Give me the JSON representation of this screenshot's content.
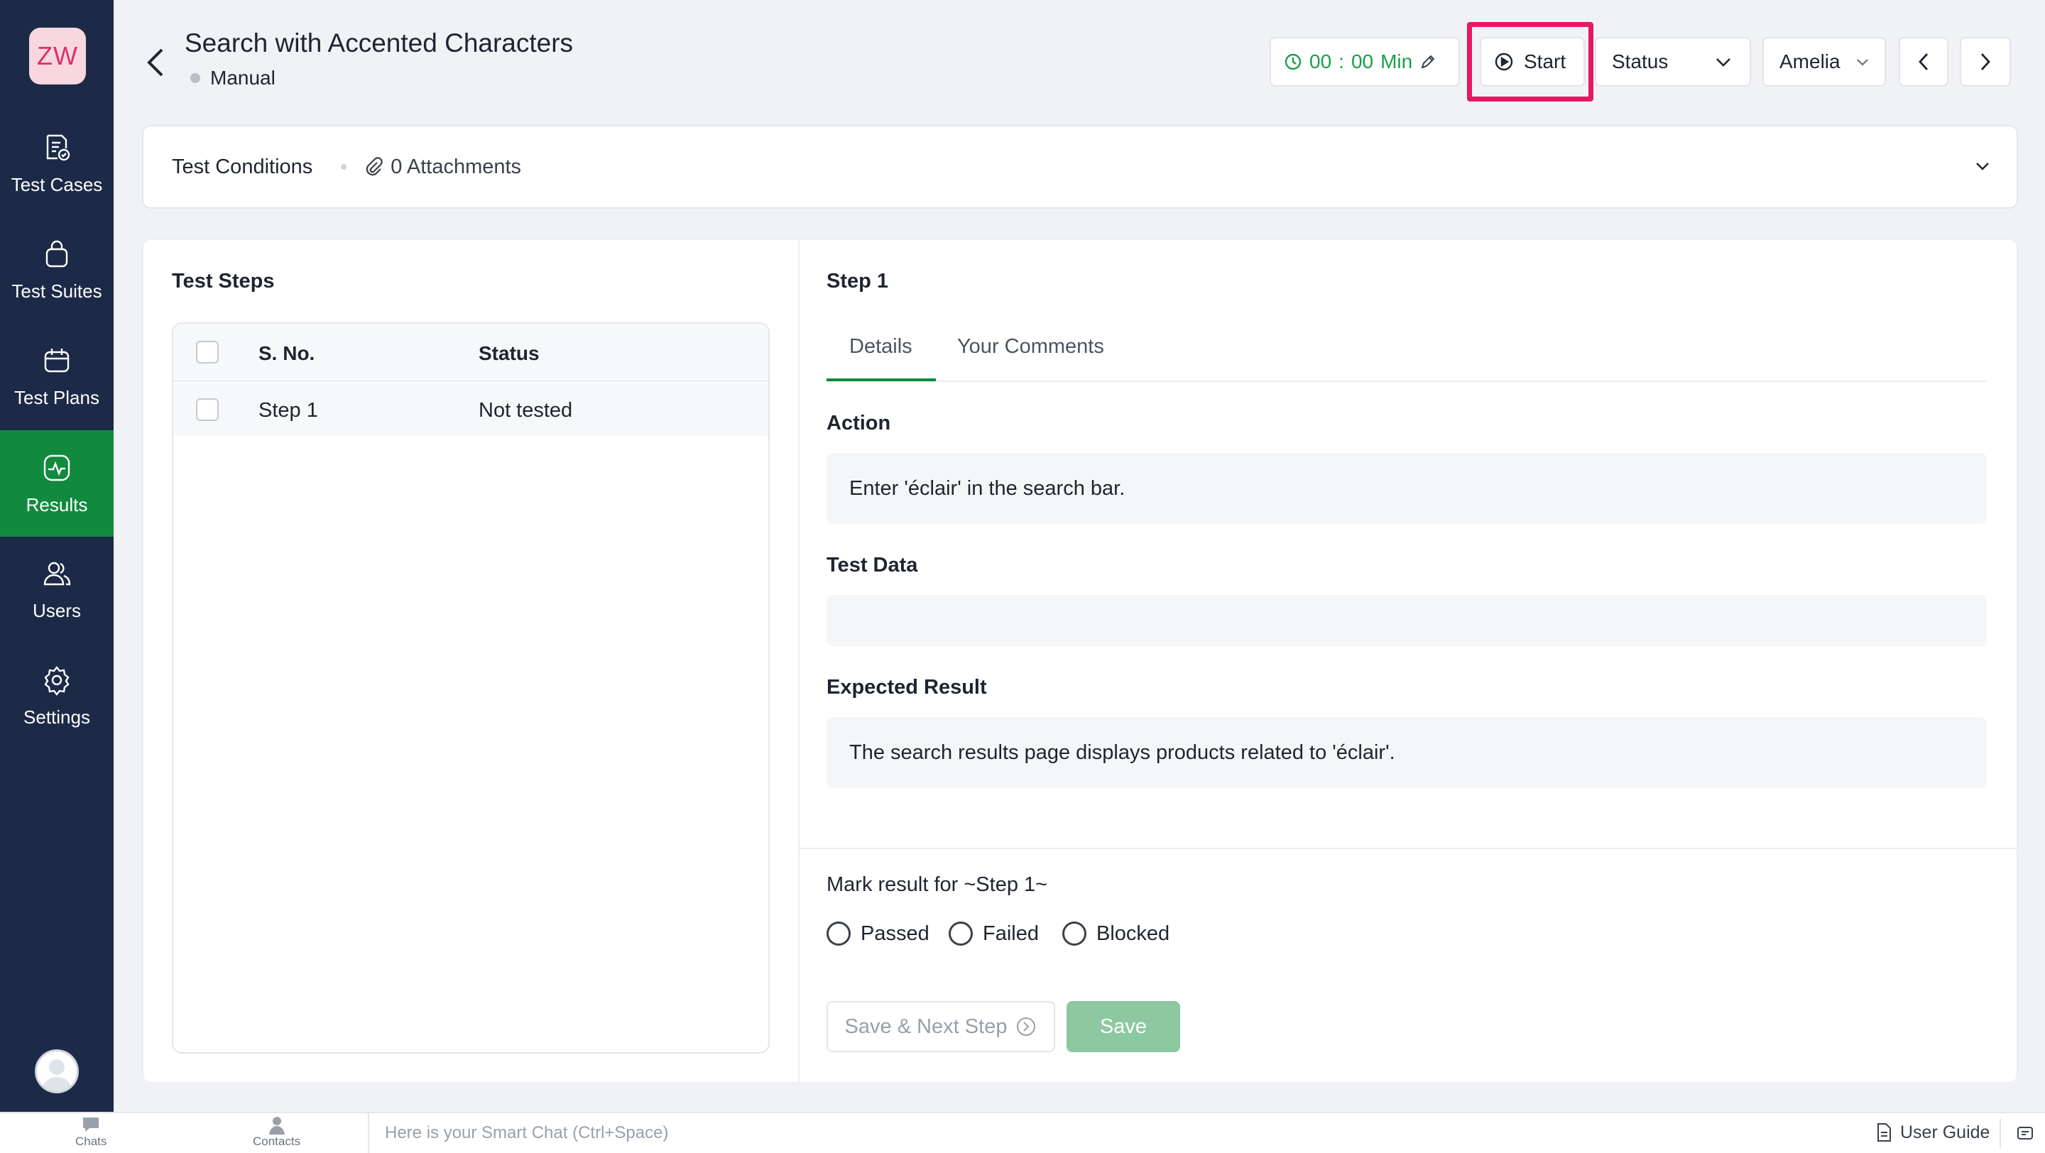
{
  "app": {
    "logo_text": "ZW"
  },
  "sidebar": {
    "items": [
      {
        "label": "Test Cases",
        "icon": "test-cases-icon"
      },
      {
        "label": "Test Suites",
        "icon": "test-suites-icon"
      },
      {
        "label": "Test Plans",
        "icon": "test-plans-icon"
      },
      {
        "label": "Results",
        "icon": "results-icon",
        "active": true
      },
      {
        "label": "Users",
        "icon": "users-icon"
      },
      {
        "label": "Settings",
        "icon": "gear-icon"
      }
    ]
  },
  "header": {
    "title": "Search with Accented Characters",
    "type": "Manual",
    "timer": {
      "hours": "00",
      "separator": ":",
      "minutes": "00",
      "unit": "Min"
    },
    "start_label": "Start",
    "status_label": "Status",
    "assignee": "Amelia"
  },
  "conditions": {
    "label": "Test Conditions",
    "attachments": "0 Attachments"
  },
  "steps": {
    "title": "Test Steps",
    "columns": [
      "S. No.",
      "Status"
    ],
    "rows": [
      {
        "sno": "Step 1",
        "status": "Not tested"
      }
    ]
  },
  "detail": {
    "title": "Step 1",
    "tabs": [
      "Details",
      "Your Comments"
    ],
    "active_tab": "Details",
    "action_label": "Action",
    "action_value": "Enter 'éclair' in the search bar.",
    "test_data_label": "Test Data",
    "test_data_value": "",
    "expected_label": "Expected Result",
    "expected_value": "The search results page displays products related to 'éclair'.",
    "mark_label": "Mark result for ~Step 1~",
    "result_options": [
      "Passed",
      "Failed",
      "Blocked"
    ],
    "save_next_label": "Save & Next Step",
    "save_label": "Save"
  },
  "footer": {
    "chats": "Chats",
    "contacts": "Contacts",
    "smart_chat_placeholder": "Here is your Smart Chat (Ctrl+Space)",
    "user_guide": "User Guide"
  },
  "colors": {
    "sidebar_bg": "#1c2a47",
    "accent_green": "#118a3e",
    "timer_green": "#18a14a",
    "highlight_pink": "#e5195f",
    "save_disabled_green": "#8cc9a1"
  }
}
